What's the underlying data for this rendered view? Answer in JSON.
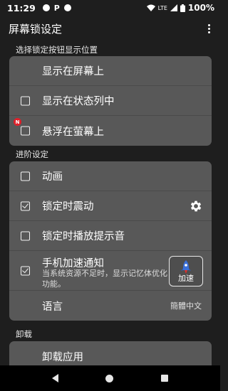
{
  "status_bar": {
    "time": "11:29",
    "network": "LTE",
    "battery": "100%"
  },
  "app_bar": {
    "title": "屏幕锁设定"
  },
  "sections": {
    "button_position": {
      "label": "选择锁定按钮显示位置",
      "items": [
        {
          "label": "显示在屏幕上",
          "checked": null
        },
        {
          "label": "显示在状态列中",
          "checked": false
        },
        {
          "label": "悬浮在萤幕上",
          "checked": false,
          "badge": "N"
        }
      ]
    },
    "advanced": {
      "label": "进阶设定",
      "items": [
        {
          "label": "动画",
          "checked": false
        },
        {
          "label": "锁定时震动",
          "checked": true
        },
        {
          "label": "锁定时播放提示音",
          "checked": false
        },
        {
          "label": "手机加速通知",
          "checked": true,
          "subtext": "当系统资源不足时，显示记忆体优化功能。",
          "button": "加速"
        },
        {
          "label": "语言",
          "value": "簡體中文"
        }
      ]
    },
    "uninstall": {
      "label": "卸载",
      "items": [
        {
          "label": "卸载应用"
        }
      ]
    }
  },
  "colors": {
    "background": "#1e1e1e",
    "card": "#585858",
    "badge": "#e0202a"
  }
}
